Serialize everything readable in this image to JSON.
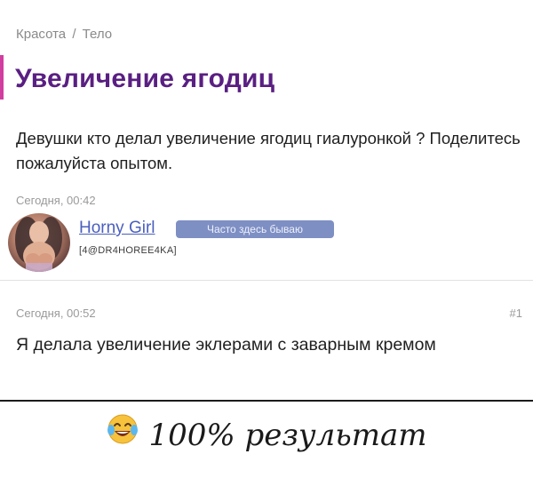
{
  "breadcrumb": {
    "items": [
      "Красота",
      "Тело"
    ],
    "separator": "/"
  },
  "topic": {
    "title": "Увеличение ягодиц",
    "question": "Девушки кто делал увеличение ягодиц гиалуронкой ? Поделитесь пожалуйста опытом.",
    "timestamp": "Сегодня, 00:42",
    "author": {
      "name": "Horny Girl",
      "badge": "Часто здесь бываю",
      "tag": "[4@DR4HOREE4KA]",
      "avatar_icon": "avatar-photo"
    }
  },
  "reply": {
    "timestamp": "Сегодня, 00:52",
    "number": "#1",
    "text": "Я делала увеличение эклерами с заварным кремом"
  },
  "caption": {
    "emoji_icon": "face-with-tears-of-joy-icon",
    "text": "100% результат"
  },
  "colors": {
    "title": "#5a1f82",
    "accent": "#d23ea0",
    "link": "#4a5fbf",
    "badge": "#7e8fc4"
  }
}
